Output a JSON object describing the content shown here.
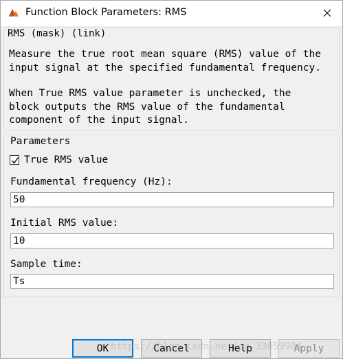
{
  "window": {
    "title": "Function Block Parameters: RMS",
    "close_icon": "close-icon"
  },
  "mask": {
    "legend": "RMS (mask) (link)",
    "description_lines": [
      "Measure the true root mean square (RMS) value of the",
      "input signal at the specified fundamental frequency.",
      "",
      "When True RMS value parameter is unchecked, the",
      "block outputs the RMS value of the fundamental",
      "component of the input signal."
    ]
  },
  "parameters": {
    "legend": "Parameters",
    "true_rms": {
      "label": "True RMS value",
      "checked": true
    },
    "fundamental_frequency": {
      "label": "Fundamental frequency (Hz):",
      "value": "50"
    },
    "initial_rms": {
      "label": "Initial RMS value:",
      "value": "10"
    },
    "sample_time": {
      "label": "Sample time:",
      "value": "Ts"
    }
  },
  "buttons": {
    "ok": "OK",
    "cancel": "Cancel",
    "help": "Help",
    "apply": "Apply"
  },
  "watermark": "https://blog.csdn.net/qq_33659904",
  "colors": {
    "accent": "#0078d7",
    "app_icon": "#e07b28"
  }
}
